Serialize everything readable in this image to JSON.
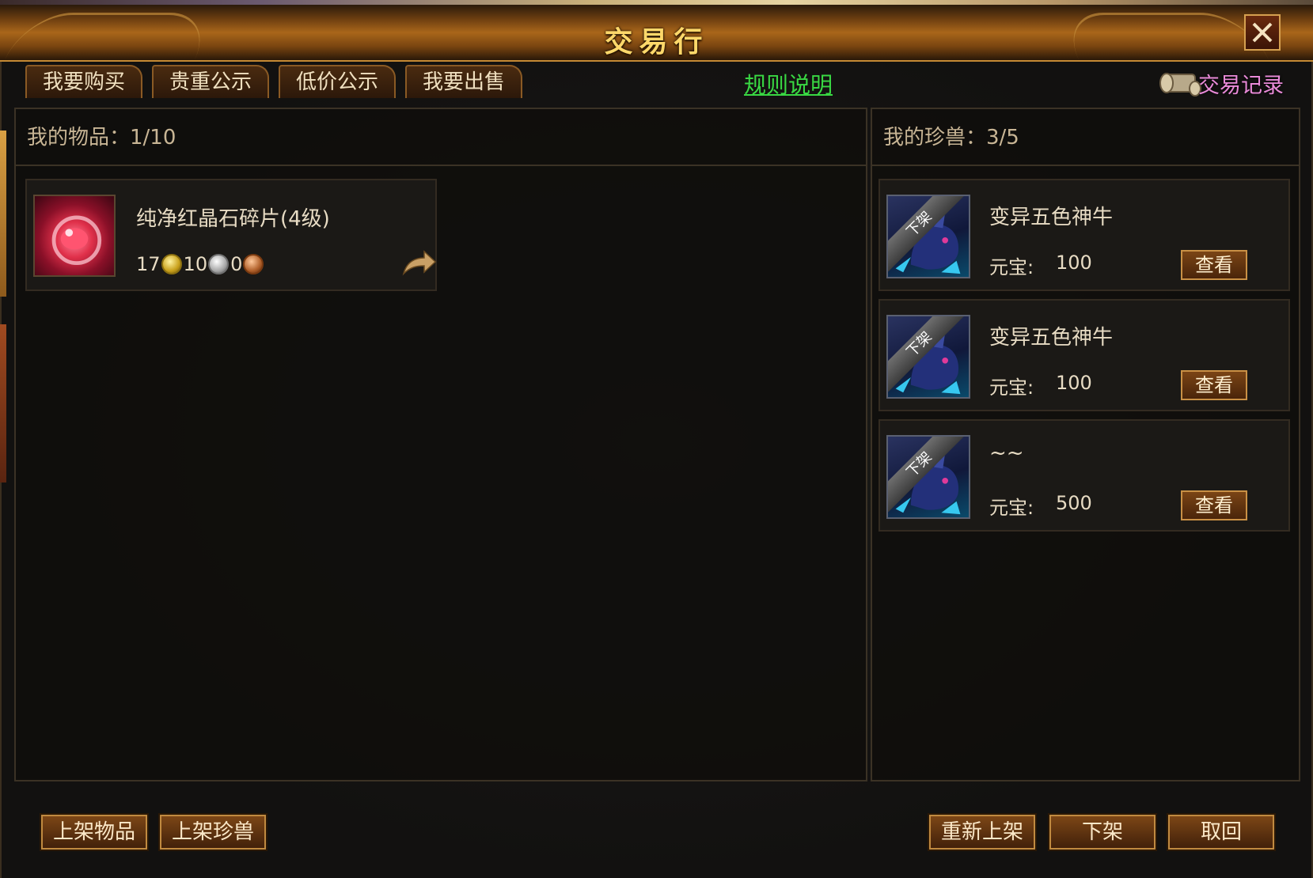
{
  "window": {
    "title": "交易行"
  },
  "tabs": [
    {
      "label": "我要购买"
    },
    {
      "label": "贵重公示"
    },
    {
      "label": "低价公示"
    },
    {
      "label": "我要出售"
    }
  ],
  "links": {
    "rules": "规则说明",
    "trade_record": "交易记录"
  },
  "items_panel": {
    "header": "我的物品：1/10",
    "items": [
      {
        "name": "纯净红晶石碎片(4级)",
        "gold": "17",
        "silver": "10",
        "copper": "0",
        "icon": "red-gem-icon"
      }
    ]
  },
  "pets_panel": {
    "header": "我的珍兽：3/5",
    "pets": [
      {
        "name": "变异五色神牛",
        "price_label": "元宝:",
        "price": "100",
        "ribbon": "下架",
        "view_label": "查看",
        "icon": "bull-icon"
      },
      {
        "name": "变异五色神牛",
        "price_label": "元宝:",
        "price": "100",
        "ribbon": "下架",
        "view_label": "查看",
        "icon": "bull-icon"
      },
      {
        "name": "~~",
        "price_label": "元宝:",
        "price": "500",
        "ribbon": "下架",
        "view_label": "查看",
        "icon": "bull-icon"
      }
    ]
  },
  "bottom_buttons": {
    "list_item": "上架物品",
    "list_pet": "上架珍兽",
    "relist": "重新上架",
    "delist": "下架",
    "retrieve": "取回"
  },
  "colors": {
    "accent": "#ffd86a",
    "link": "#39d843",
    "record": "#e98ad8"
  }
}
